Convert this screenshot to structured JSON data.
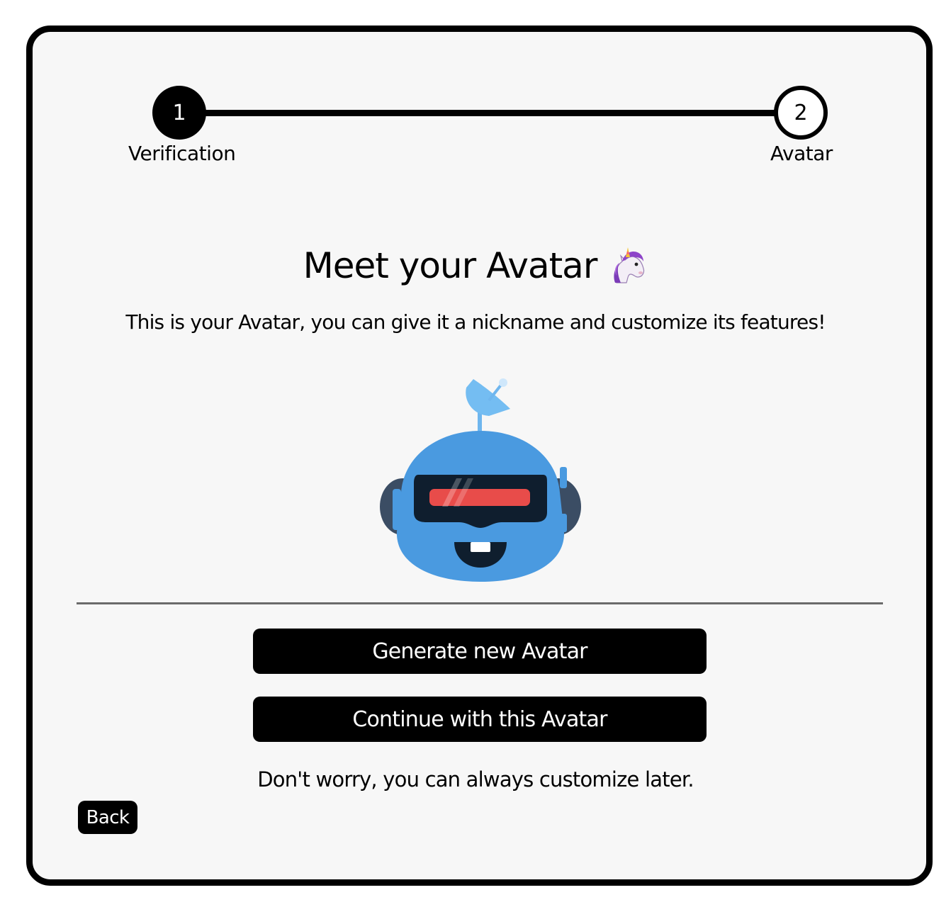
{
  "stepper": {
    "steps": [
      {
        "number": "1",
        "label": "Verification",
        "state": "completed"
      },
      {
        "number": "2",
        "label": "Avatar",
        "state": "current"
      }
    ]
  },
  "main": {
    "title": "Meet your Avatar",
    "title_emoji_icon": "unicorn-icon",
    "subtitle": "This is your Avatar, you can give it a nickname and customize its features!",
    "avatar_icon": "robot-avatar-icon"
  },
  "actions": {
    "generate_label": "Generate new Avatar",
    "continue_label": "Continue with this Avatar",
    "note": "Don't worry, you can always customize later.",
    "back_label": "Back"
  },
  "colors": {
    "primary": "#000000",
    "card_background": "#f7f7f7",
    "avatar_blue": "#4a9ae0",
    "visor_red": "#e84c4a"
  }
}
